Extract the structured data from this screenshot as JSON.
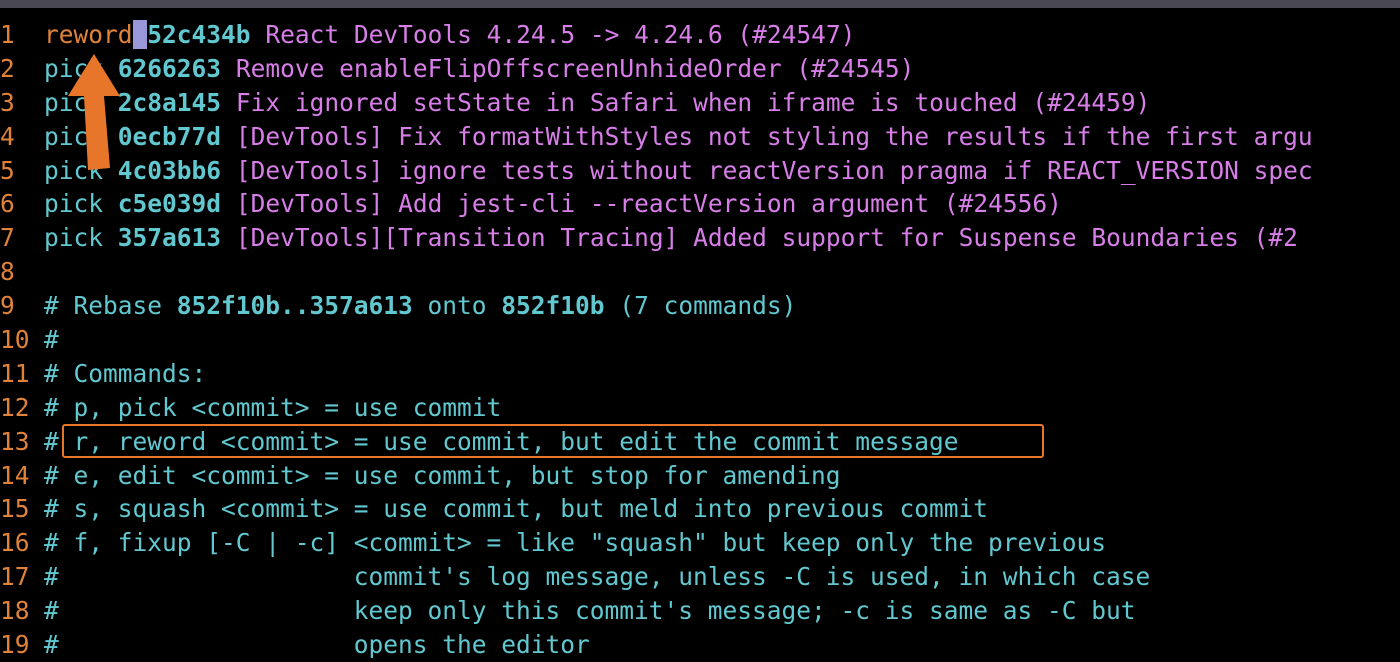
{
  "colors": {
    "background": "#000000",
    "line_number": "#e0833a",
    "command": "#62c8d0",
    "hash": "#62c8d0",
    "message": "#d87ee8",
    "comment": "#62c8d0",
    "annotation": "#e8762a",
    "cursor": "#9a97d8"
  },
  "todo": [
    {
      "num": "1",
      "cmd": "reword",
      "hash": "52c434b",
      "msg": "React DevTools 4.24.5 -> 4.24.6 (#24547)"
    },
    {
      "num": "2",
      "cmd": "pick",
      "hash": "6266263",
      "msg": "Remove enableFlipOffscreenUnhideOrder (#24545)"
    },
    {
      "num": "3",
      "cmd": "pick",
      "hash": "2c8a145",
      "msg": "Fix ignored setState in Safari when iframe is touched (#24459)"
    },
    {
      "num": "4",
      "cmd": "pick",
      "hash": "0ecb77d",
      "msg": "[DevTools] Fix formatWithStyles not styling the results if the first argu"
    },
    {
      "num": "5",
      "cmd": "pick",
      "hash": "4c03bb6",
      "msg": "[DevTools] ignore tests without reactVersion pragma if REACT_VERSION spec"
    },
    {
      "num": "6",
      "cmd": "pick",
      "hash": "c5e039d",
      "msg": "[DevTools] Add jest-cli --reactVersion argument (#24556)"
    },
    {
      "num": "7",
      "cmd": "pick",
      "hash": "357a613",
      "msg": "[DevTools][Transition Tracing] Added support for Suspense Boundaries (#2"
    }
  ],
  "blank_line": {
    "num": "8"
  },
  "rebase_line": {
    "num": "9",
    "prefix": "# Rebase ",
    "range": "852f10b..357a613",
    "mid": " onto ",
    "onto": "852f10b",
    "suffix": " (7 commands)"
  },
  "comments": [
    {
      "num": "10",
      "text": "#"
    },
    {
      "num": "11",
      "text": "# Commands:"
    },
    {
      "num": "12",
      "text": "# p, pick <commit> = use commit"
    },
    {
      "num": "13",
      "text": "# r, reword <commit> = use commit, but edit the commit message"
    },
    {
      "num": "14",
      "text": "# e, edit <commit> = use commit, but stop for amending"
    },
    {
      "num": "15",
      "text": "# s, squash <commit> = use commit, but meld into previous commit"
    },
    {
      "num": "16",
      "text": "# f, fixup [-C | -c] <commit> = like \"squash\" but keep only the previous"
    },
    {
      "num": "17",
      "text": "#                    commit's log message, unless -C is used, in which case"
    },
    {
      "num": "18",
      "text": "#                    keep only this commit's message; -c is same as -C but"
    },
    {
      "num": "19",
      "text": "#                    opens the editor"
    }
  ],
  "annotation": {
    "arrow_icon": "up-arrow-icon",
    "highlight": "highlight-box"
  }
}
